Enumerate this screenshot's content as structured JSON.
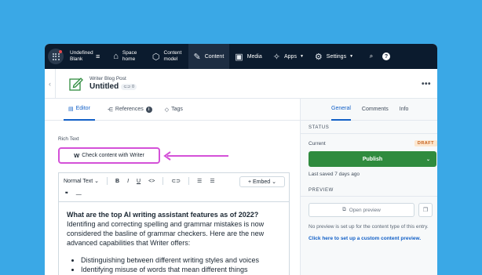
{
  "colors": {
    "background": "#3aa8e6",
    "topbar": "#0b1b2e",
    "accent": "#1260c7",
    "publish": "#2f8b3e",
    "highlight": "#d451d8",
    "draft_badge_bg": "#fce7cf",
    "draft_badge_text": "#c5601c"
  },
  "topbar": {
    "space_name": "Undefined Blank",
    "nav": [
      {
        "label": "Space home",
        "icon": "home-icon"
      },
      {
        "label": "Content model",
        "icon": "cube-icon"
      },
      {
        "label": "Content",
        "icon": "edit-icon",
        "active": true
      },
      {
        "label": "Media",
        "icon": "image-icon"
      },
      {
        "label": "Apps",
        "icon": "puzzle-icon",
        "dropdown": true
      },
      {
        "label": "Settings",
        "icon": "gear-icon",
        "dropdown": true
      }
    ]
  },
  "entry": {
    "type": "Writer Blog Post",
    "title": "Untitled",
    "badge": "0"
  },
  "editor_tabs": [
    {
      "label": "Editor",
      "active": true
    },
    {
      "label": "References"
    },
    {
      "label": "Tags"
    }
  ],
  "field": {
    "label": "Rich Text",
    "writer_button": "Check content with Writer"
  },
  "toolbar": {
    "format": "Normal Text",
    "embed": "+ Embed"
  },
  "content": {
    "heading": "What are the top AI writing assistant features as of 2022?",
    "paragraph": " Identifing and correcting spelling and grammar mistakes is now considered the basline of grammar checkers. Here are the new advanced capabilities that Writer offers:",
    "bullets": [
      "Distinguishing between different writing styles and voices",
      "Identifying misuse of words that mean different things"
    ]
  },
  "sidebar": {
    "tabs": [
      {
        "label": "General",
        "active": true
      },
      {
        "label": "Comments"
      },
      {
        "label": "Info"
      }
    ],
    "status_title": "STATUS",
    "current_label": "Current",
    "status_badge": "DRAFT",
    "publish_label": "Publish",
    "last_saved": "Last saved 7 days ago",
    "preview_title": "PREVIEW",
    "open_preview": "Open preview",
    "preview_note": "No preview is set up for the content type of this entry.",
    "preview_link": "Click here to set up a custom content preview."
  }
}
